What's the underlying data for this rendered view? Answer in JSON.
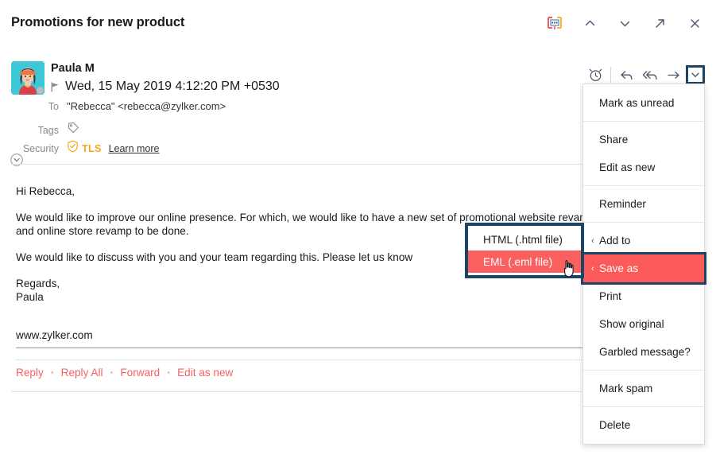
{
  "header": {
    "subject": "Promotions for new product",
    "actions": [
      {
        "name": "summary-icon",
        "label": "Summary"
      },
      {
        "name": "chevron-up-icon",
        "label": "Previous message"
      },
      {
        "name": "chevron-down-icon",
        "label": "Next message"
      },
      {
        "name": "open-in-new-icon",
        "label": "Open in new window"
      },
      {
        "name": "close-icon",
        "label": "Close"
      }
    ]
  },
  "message": {
    "sender_name": "Paula M",
    "sent_date": "Wed, 15 May 2019 4:12:20 PM +0530",
    "to_label": "To",
    "to_value": "\"Rebecca\" <rebecca@zylker.com>",
    "tags_label": "Tags",
    "security_label": "Security",
    "security_value": "TLS",
    "security_link": "Learn more",
    "body": [
      "Hi Rebecca,",
      "We would like to improve our online presence. For which, we would like to have a new set of promotional website revamp, a promo video and online store revamp to be done.",
      "We would like to discuss with you and your team regarding this. Please let us know",
      "Regards,\nPaula"
    ],
    "signature_url": "www.zylker.com",
    "actions": [
      {
        "name": "reminder-icon",
        "label": "Reminder"
      },
      {
        "name": "reply-icon",
        "label": "Reply"
      },
      {
        "name": "reply-all-icon",
        "label": "Reply All"
      },
      {
        "name": "forward-icon",
        "label": "Forward"
      },
      {
        "name": "more-actions-chevron-icon",
        "label": "More actions"
      }
    ]
  },
  "footer": {
    "links": [
      "Reply",
      "Reply All",
      "Forward",
      "Edit as new"
    ],
    "separator": "•"
  },
  "more_menu": {
    "items": [
      {
        "label": "Mark as unread",
        "submenu": false,
        "selected": false,
        "separator_after": true
      },
      {
        "label": "Share",
        "submenu": false,
        "selected": false,
        "separator_after": false
      },
      {
        "label": "Edit as new",
        "submenu": false,
        "selected": false,
        "separator_after": true
      },
      {
        "label": "Reminder",
        "submenu": false,
        "selected": false,
        "separator_after": true
      },
      {
        "label": "Add to",
        "submenu": true,
        "selected": false,
        "separator_after": false
      },
      {
        "label": "Save as",
        "submenu": true,
        "selected": true,
        "separator_after": false
      },
      {
        "label": "Print",
        "submenu": false,
        "selected": false,
        "separator_after": false
      },
      {
        "label": "Show original",
        "submenu": false,
        "selected": false,
        "separator_after": false
      },
      {
        "label": "Garbled message?",
        "submenu": false,
        "selected": false,
        "separator_after": true
      },
      {
        "label": "Mark spam",
        "submenu": false,
        "selected": false,
        "separator_after": true
      },
      {
        "label": "Delete",
        "submenu": false,
        "selected": false,
        "separator_after": false
      }
    ],
    "submenu_arrow": "‹"
  },
  "save_as_submenu": {
    "items": [
      {
        "label": "HTML (.html file)",
        "selected": false
      },
      {
        "label": "EML (.eml file)",
        "selected": true
      }
    ]
  },
  "colors": {
    "accent_red": "#fa5a5a",
    "highlight_border": "#1b4566",
    "tls_orange": "#f5a623",
    "link_red": "#fa6060",
    "icon_slate": "#44546b"
  }
}
